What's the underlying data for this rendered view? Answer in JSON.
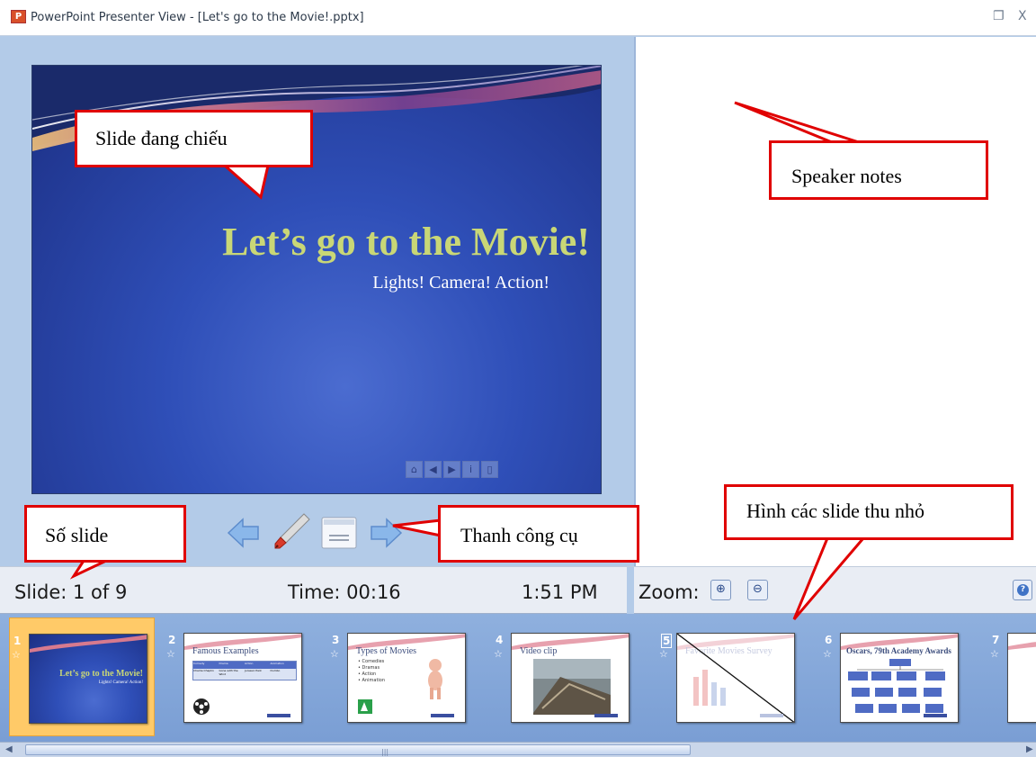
{
  "window": {
    "title": "PowerPoint Presenter View - [Let's go to the Movie!.pptx]",
    "restore_glyph": "❐",
    "close_glyph": "X"
  },
  "current_slide": {
    "title": "Let’s go to the Movie!",
    "subtitle": "Lights! Camera! Action!"
  },
  "status": {
    "slide": "Slide: 1 of 9",
    "time": "Time: 00:16",
    "clock": "1:51 PM",
    "zoom_label": "Zoom:"
  },
  "thumbnails": [
    {
      "num": "1",
      "title": "Let’s go to the Movie!",
      "selected": true
    },
    {
      "num": "2",
      "title": "Famous Examples"
    },
    {
      "num": "3",
      "title": "Types of Movies"
    },
    {
      "num": "4",
      "title": "Video clip"
    },
    {
      "num": "5",
      "title": "Favorite Movies Survey"
    },
    {
      "num": "6",
      "title": "Oscars, 79th Academy Awards"
    },
    {
      "num": "7",
      "title": ""
    }
  ],
  "thumb_details": {
    "thumb3_bullets": [
      "Comedies",
      "Dramas",
      "Action",
      "Animation"
    ],
    "thumb2_headers": [
      "Comedy",
      "Drama",
      "Action",
      "Animation"
    ],
    "thumb2_row": [
      "Charlie Chaplin",
      "Gone with the Wind",
      "Jurassic Park",
      "Dumbo"
    ]
  },
  "callouts": {
    "current_slide": "Slide đang chiếu",
    "speaker_notes": "Speaker notes",
    "slide_number": "Số slide",
    "toolbar": "Thanh công cụ",
    "thumbnails": "Hình các slide thu nhỏ"
  },
  "colors": {
    "callout_border": "#e00000",
    "slide_title": "#c9d776",
    "selected_thumb": "#ffca68"
  }
}
